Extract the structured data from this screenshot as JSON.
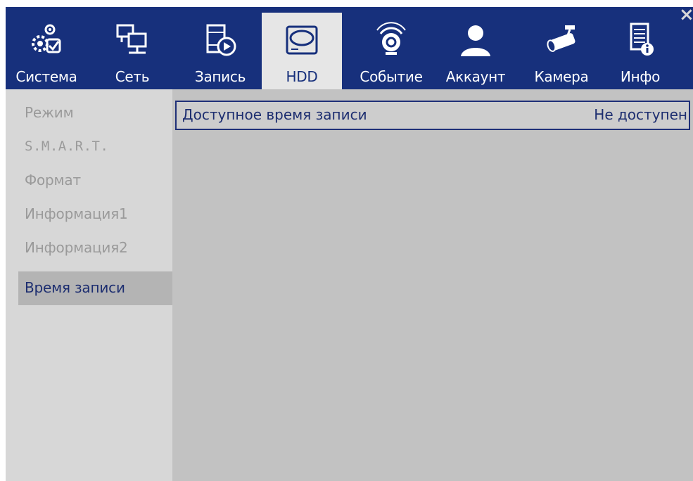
{
  "tabs": [
    {
      "label": "Система",
      "icon": "system-gears-icon"
    },
    {
      "label": "Сеть",
      "icon": "network-monitors-icon"
    },
    {
      "label": "Запись",
      "icon": "record-film-icon"
    },
    {
      "label": "HDD",
      "icon": "hdd-icon"
    },
    {
      "label": "Событие",
      "icon": "event-alarm-icon"
    },
    {
      "label": "Аккаунт",
      "icon": "account-user-icon"
    },
    {
      "label": "Камера",
      "icon": "camera-icon"
    },
    {
      "label": "Инфо",
      "icon": "info-document-icon"
    }
  ],
  "active_tab": "HDD",
  "close_label": "×",
  "sidebar": {
    "items": [
      {
        "label": "Режим"
      },
      {
        "label": "S.M.A.R.T."
      },
      {
        "label": "Формат"
      },
      {
        "label": "Информация1"
      },
      {
        "label": "Информация2"
      },
      {
        "label": "Время записи"
      }
    ],
    "active": "Время записи"
  },
  "content": {
    "label": "Доступное время записи",
    "value": "Не доступен"
  },
  "colors": {
    "header_bg": "#17307c",
    "active_tab_bg": "#e6e6e6",
    "sidebar_bg": "#d7d7d7",
    "content_bg": "#c2c2c2",
    "accent_text": "#1d2e70"
  }
}
